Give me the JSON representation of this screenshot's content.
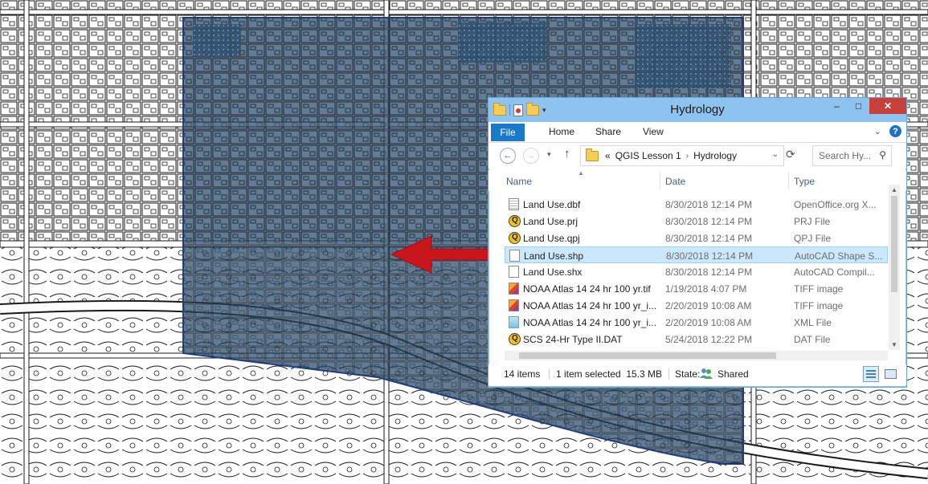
{
  "window": {
    "title": "Hydrology",
    "controls": {
      "minimize": "–",
      "maximize": "□",
      "close": "✕"
    }
  },
  "ribbon": {
    "tabs": [
      {
        "label": "File"
      },
      {
        "label": "Home"
      },
      {
        "label": "Share"
      },
      {
        "label": "View"
      }
    ],
    "help_label": "?"
  },
  "address_bar": {
    "prefix": "«",
    "path": [
      "QGIS Lesson 1",
      "Hydrology"
    ],
    "search_placeholder": "Search Hy..."
  },
  "file_list": {
    "columns": [
      "Name",
      "Date",
      "Type"
    ],
    "items": [
      {
        "name": "Land Use.dbf",
        "date": "8/30/2018 12:14 PM",
        "type": "OpenOffice.org X...",
        "icon": "dbf-file-icon"
      },
      {
        "name": "Land Use.prj",
        "date": "8/30/2018 12:14 PM",
        "type": "PRJ File",
        "icon": "qgis-file-icon"
      },
      {
        "name": "Land Use.qpj",
        "date": "8/30/2018 12:14 PM",
        "type": "QPJ File",
        "icon": "qgis-file-icon"
      },
      {
        "name": "Land Use.shp",
        "date": "8/30/2018 12:14 PM",
        "type": "AutoCAD Shape S...",
        "icon": "blank-file-icon",
        "selected": true
      },
      {
        "name": "Land Use.shx",
        "date": "8/30/2018 12:14 PM",
        "type": "AutoCAD Compil...",
        "icon": "blank-file-icon"
      },
      {
        "name": "NOAA Atlas 14 24 hr 100 yr.tif",
        "date": "1/19/2018 4:07 PM",
        "type": "TIFF image",
        "icon": "tiff-file-icon"
      },
      {
        "name": "NOAA Atlas 14 24 hr 100 yr_i...",
        "date": "2/20/2019 10:08 AM",
        "type": "TIFF image",
        "icon": "tiff-file-icon"
      },
      {
        "name": "NOAA Atlas 14 24 hr 100 yr_i...",
        "date": "2/20/2019 10:08 AM",
        "type": "XML File",
        "icon": "xml-file-icon"
      },
      {
        "name": "SCS 24-Hr Type II.DAT",
        "date": "5/24/2018 12:22 PM",
        "type": "DAT File",
        "icon": "qgis-file-icon"
      }
    ]
  },
  "status_bar": {
    "item_count": "14 items",
    "selection": "1 item selected  15.3 MB",
    "state_label": "State:",
    "state_value": "Shared"
  },
  "colors": {
    "map_lines": "#1a1a1a",
    "layer_fill": "#274a6b",
    "layer_outline": "#1f3f8a",
    "arrow": "#c8161d",
    "titlebar": "#8ec3ef",
    "file_tab": "#1979ca",
    "selection": "#cce8ff"
  }
}
